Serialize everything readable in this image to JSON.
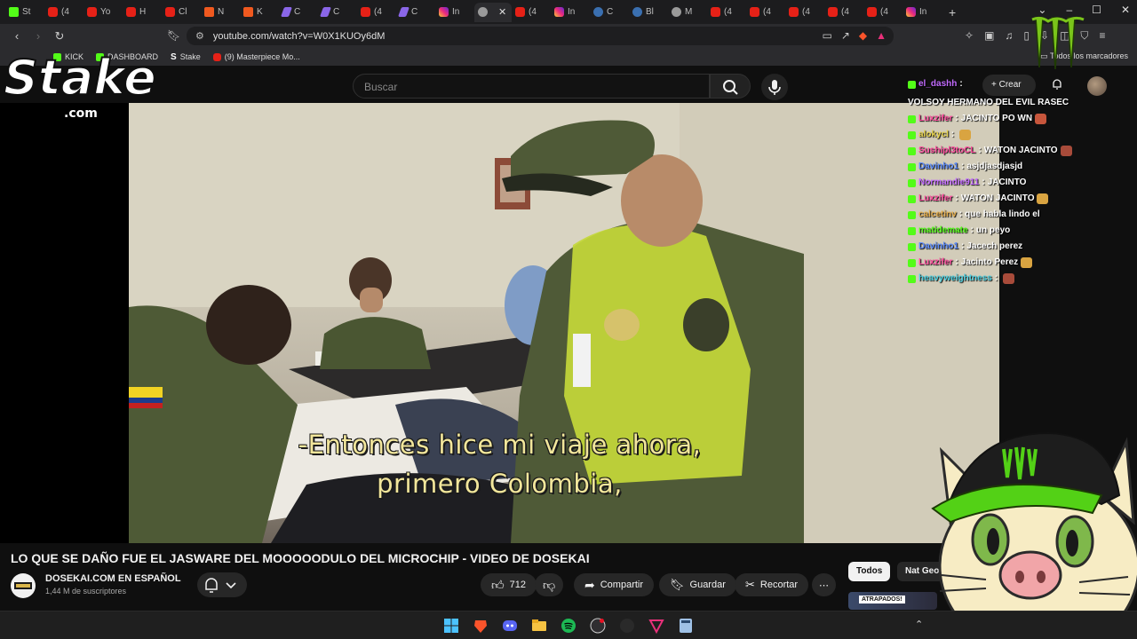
{
  "tabs": [
    {
      "icon": "kick-favicon",
      "label": "St"
    },
    {
      "icon": "youtube-favicon",
      "label": "(4"
    },
    {
      "icon": "youtube-favicon",
      "label": "Yo"
    },
    {
      "icon": "kick-red-favicon",
      "label": "H"
    },
    {
      "icon": "kick-red-favicon",
      "label": "Cl"
    },
    {
      "icon": "mango-favicon",
      "label": "N"
    },
    {
      "icon": "mango-favicon",
      "label": "K"
    },
    {
      "icon": "pen-favicon",
      "label": "C"
    },
    {
      "icon": "pen-favicon",
      "label": "C"
    },
    {
      "icon": "youtube-favicon",
      "label": "(4"
    },
    {
      "icon": "pen-favicon",
      "label": "C"
    },
    {
      "icon": "instagram-favicon",
      "label": "In"
    },
    {
      "icon": "audio-favicon",
      "label": "",
      "active": true
    },
    {
      "icon": "youtube-favicon",
      "label": "(4"
    },
    {
      "icon": "instagram-favicon",
      "label": "In"
    },
    {
      "icon": "circle-favicon",
      "label": "C"
    },
    {
      "icon": "circle-favicon",
      "label": "Bl"
    },
    {
      "icon": "gray-favicon",
      "label": "M"
    },
    {
      "icon": "youtube-favicon",
      "label": "(4"
    },
    {
      "icon": "youtube-favicon",
      "label": "(4"
    },
    {
      "icon": "youtube-favicon",
      "label": "(4"
    },
    {
      "icon": "youtube-favicon",
      "label": "(4"
    },
    {
      "icon": "youtube-favicon",
      "label": "(4"
    },
    {
      "icon": "instagram-favicon",
      "label": "In"
    }
  ],
  "address": {
    "url": "youtube.com/watch?v=W0X1KUOy6dM"
  },
  "bookmarks": {
    "items": [
      {
        "label": "KICK"
      },
      {
        "label": "DASHBOARD"
      },
      {
        "label": "Stake"
      },
      {
        "label": "(9) Masterpiece Mo..."
      }
    ],
    "all_label": "Todos los marcadores"
  },
  "youtube": {
    "search_placeholder": "Buscar",
    "create_label": "Crear"
  },
  "video": {
    "subtitle_line1": "-Entonces hice mi viaje ahora,",
    "subtitle_line2": "primero Colombia,",
    "title": "LO QUE SE DAÑO FUE EL JASWARE DEL MOOOOODULO DEL MICROCHIP - VIDEO DE DOSEKAI",
    "channel": "DOSEKAI.COM EN ESPAÑOL",
    "subscribers": "1,44 M de suscriptores",
    "likes": "712",
    "share_label": "Compartir",
    "save_label": "Guardar",
    "clip_label": "Recortar"
  },
  "chips": {
    "all": "Todos",
    "natgeo": "Nat Geo"
  },
  "thumb_label": "ATRAPADOS!",
  "overlay": {
    "stake_text": "Stake",
    "stake_suffix": ".com"
  },
  "chat": [
    {
      "user": "el_dashh",
      "user_color": "#c36cff",
      "message": "VOLSOY HERMANO DEL EVIL RASEC"
    },
    {
      "user": "Luxzifer",
      "user_color": "#ff4fa0",
      "message": "JACINTO PO WN",
      "emote": true
    },
    {
      "user": "alokycl",
      "user_color": "#e8d44d",
      "message": "",
      "emote": true
    },
    {
      "user": "Sushipl3toCL",
      "user_color": "#ff4fa0",
      "message": "WATON JACINTO",
      "emote": true
    },
    {
      "user": "Davinho1",
      "user_color": "#5b8cff",
      "message": "asjdjasdjasjd"
    },
    {
      "user": "Normandie911",
      "user_color": "#c36cff",
      "message": "JACINTO"
    },
    {
      "user": "Luxzifer",
      "user_color": "#ff4fa0",
      "message": "WATON JACINTO",
      "emote": true
    },
    {
      "user": "calcetinv",
      "user_color": "#e8b04d",
      "message": "que habla lindo el"
    },
    {
      "user": "matidemate",
      "user_color": "#53fc18",
      "message": "un peyo"
    },
    {
      "user": "Davinho1",
      "user_color": "#5b8cff",
      "message": "Jacech perez"
    },
    {
      "user": "Luxzifer",
      "user_color": "#ff4fa0",
      "message": "Jacinto Perez",
      "emote": true
    },
    {
      "user": "heavyweightness",
      "user_color": "#4dd0e1",
      "message": "",
      "emote": true
    }
  ]
}
